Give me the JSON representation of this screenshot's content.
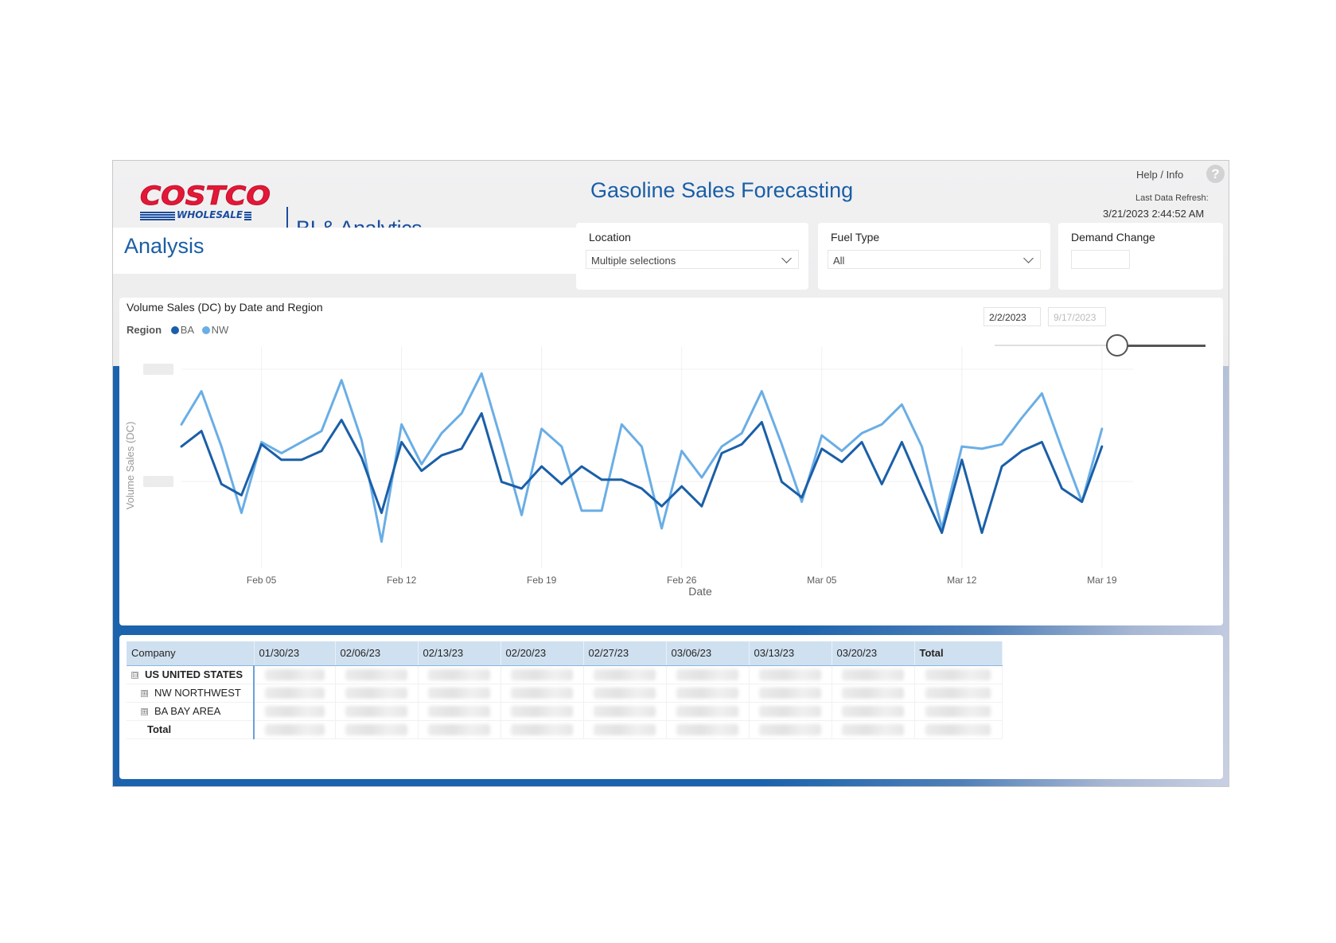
{
  "header": {
    "logo_name": "COSTCO",
    "logo_sub": "WHOLESALE",
    "logo_product": "BI & Analytics",
    "report_title": "Gasoline Sales Forecasting",
    "help_label": "Help / Info",
    "help_icon": "?",
    "refresh_label": "Last Data Refresh:",
    "refresh_value": "3/21/2023 2:44:52 AM"
  },
  "page": {
    "title": "Analysis"
  },
  "slicers": {
    "location": {
      "label": "Location",
      "value": "Multiple selections"
    },
    "fuel_type": {
      "label": "Fuel Type",
      "value": "All"
    },
    "demand_change": {
      "label": "Demand Change",
      "value": ""
    }
  },
  "date_range": {
    "start": "2/2/2023",
    "end": "9/17/2023",
    "slider_position": 0.58
  },
  "chart": {
    "title": "Volume Sales (DC) by Date and Region",
    "legend_title": "Region",
    "legend": [
      {
        "name": "BA",
        "color": "#1a5fa8"
      },
      {
        "name": "NW",
        "color": "#6aaee6"
      }
    ]
  },
  "chart_data": {
    "type": "line",
    "title": "Volume Sales (DC) by Date and Region",
    "xlabel": "Date",
    "ylabel": "Volume Sales (DC)",
    "x_ticks": [
      "Feb 05",
      "Feb 12",
      "Feb 19",
      "Feb 26",
      "Mar 05",
      "Mar 12",
      "Mar 19"
    ],
    "x_range": [
      "2023-02-01",
      "2023-03-20"
    ],
    "y_tick_labels_obscured": true,
    "y_range": [
      0,
      100
    ],
    "x": [
      "2023-02-01",
      "2023-02-02",
      "2023-02-03",
      "2023-02-04",
      "2023-02-05",
      "2023-02-06",
      "2023-02-07",
      "2023-02-08",
      "2023-02-09",
      "2023-02-10",
      "2023-02-11",
      "2023-02-12",
      "2023-02-13",
      "2023-02-14",
      "2023-02-15",
      "2023-02-16",
      "2023-02-17",
      "2023-02-18",
      "2023-02-19",
      "2023-02-20",
      "2023-02-21",
      "2023-02-22",
      "2023-02-23",
      "2023-02-24",
      "2023-02-25",
      "2023-02-26",
      "2023-02-27",
      "2023-02-28",
      "2023-03-01",
      "2023-03-02",
      "2023-03-03",
      "2023-03-04",
      "2023-03-05",
      "2023-03-06",
      "2023-03-07",
      "2023-03-08",
      "2023-03-09",
      "2023-03-10",
      "2023-03-11",
      "2023-03-12",
      "2023-03-13",
      "2023-03-14",
      "2023-03-15",
      "2023-03-16",
      "2023-03-17",
      "2023-03-18",
      "2023-03-19",
      "2023-03-20"
    ],
    "series": [
      {
        "name": "BA",
        "color": "#1a5fa8",
        "values": [
          55,
          62,
          38,
          33,
          56,
          49,
          49,
          53,
          67,
          50,
          25,
          57,
          44,
          51,
          54,
          70,
          39,
          36,
          46,
          38,
          46,
          40,
          40,
          36,
          28,
          37,
          28,
          52,
          56,
          66,
          39,
          32,
          54,
          48,
          57,
          38,
          57,
          36,
          16,
          49,
          16,
          46,
          53,
          57,
          36,
          30,
          55
        ]
      },
      {
        "name": "NW",
        "color": "#6aaee6",
        "values": [
          65,
          80,
          55,
          25,
          57,
          52,
          57,
          62,
          85,
          58,
          12,
          65,
          47,
          61,
          70,
          88,
          57,
          24,
          63,
          55,
          26,
          26,
          65,
          55,
          18,
          53,
          41,
          55,
          61,
          80,
          56,
          30,
          60,
          53,
          61,
          65,
          74,
          55,
          18,
          55,
          54,
          56,
          68,
          79,
          54,
          30,
          63
        ]
      }
    ]
  },
  "table": {
    "columns": [
      "Company",
      "01/30/23",
      "02/06/23",
      "02/13/23",
      "02/20/23",
      "02/27/23",
      "03/06/23",
      "03/13/23",
      "03/20/23",
      "Total"
    ],
    "rows": [
      {
        "expander": "⊟",
        "label": "US UNITED STATES"
      },
      {
        "expander": "⊞",
        "label": "NW NORTHWEST"
      },
      {
        "expander": "⊞",
        "label": "BA BAY AREA"
      },
      {
        "expander": "",
        "label": "Total"
      }
    ]
  }
}
